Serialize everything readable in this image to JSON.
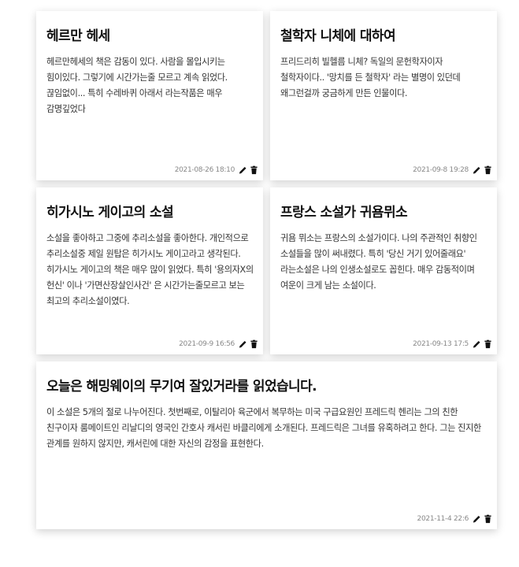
{
  "posts": [
    {
      "title": "헤르만 헤세",
      "body": "헤르만헤세의 책은 감동이 있다. 사람을 몰입시키는 힘이있다. 그렇기에 시간가는줄 모르고 계속 읽었다. 끊임없이... 특히 수레바퀴 아래서 라는작품은 매우 감명깊었다",
      "date": "2021-08-26 18:10"
    },
    {
      "title": "철학자 니체에 대하여",
      "body": "프리드리히 빌헬름 니체? 독일의 문헌학자이자 철학자이다.. '망치를 든 철학자' 라는 별명이 있던데 왜그런걸까 궁금하게 만든 인물이다.",
      "date": "2021-09-8 19:28"
    },
    {
      "title": "히가시노 게이고의 소설",
      "body": "소설을 좋아하고 그중에 추리소설을 좋아한다. 개인적으로 추리소설중 제일 원탑은 히가시노 게이고라고 생각된다. 히가시노 게이고의 책은 매우 많이 읽었다. 특히 '용의자X의 헌신' 이나 '가면산장살인사건' 은 시간가는줄모르고 보는 최고의 추리소설이였다.",
      "date": "2021-09-9 16:56"
    },
    {
      "title": "프랑스 소설가 귀욤뮈소",
      "body": "귀욤 뮈소는 프랑스의 소설가이다. 나의 주관적인 취향인 소설들을 많이 써내렸다. 특히 '당신 거기 있어줄래요' 라는소설은 나의 인생소설로도 꼽힌다. 매우 감동적이며 여운이 크게 남는 소설이다.",
      "date": "2021-09-13 17:5"
    },
    {
      "title": "오늘은 해밍웨이의 무기여 잘있거라를 읽었습니다.",
      "body": "이 소설은 5개의 절로 나누어진다. 첫번째로, 이탈리아 육군에서 복무하는 미국 구급요원인 프레드릭 헨리는 그의 친한 친구이자 룸메이트인 리날디의 영국인 간호사 캐서린 바클리에게 소개된다. 프레드릭은 그녀를 유혹하려고 한다. 그는 진지한 관계를 원하지 않지만, 캐서린에 대한 자신의 감정을 표현한다.",
      "date": "2021-11-4 22:6"
    }
  ],
  "icons": {
    "edit": "pencil-icon",
    "delete": "trash-icon"
  },
  "colors": {
    "card_bg": "#ffffff",
    "icon": "#111111",
    "date": "#888888"
  }
}
